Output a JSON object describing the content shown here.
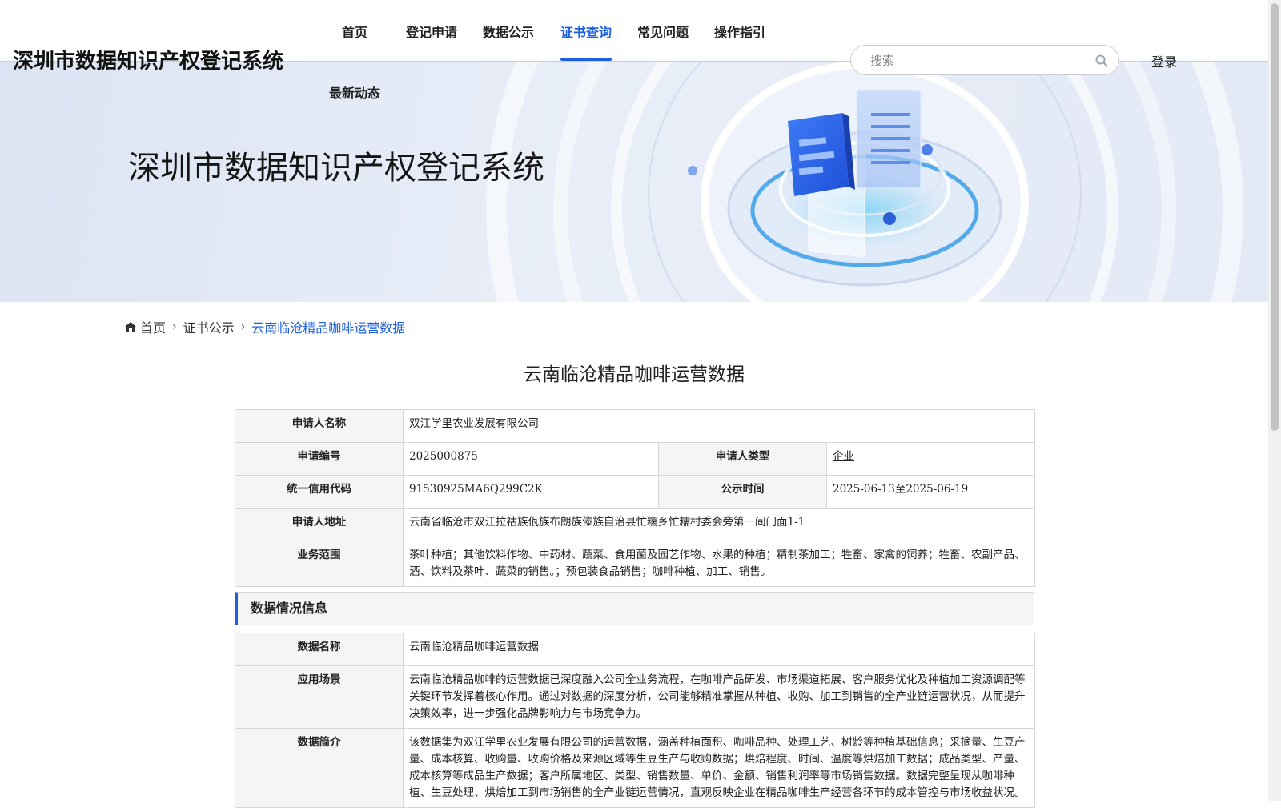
{
  "header": {
    "site_title": "深圳市数据知识产权登记系统",
    "nav": [
      {
        "label": "首页"
      },
      {
        "label": "登记申请"
      },
      {
        "label": "数据公示"
      },
      {
        "label": "证书查询",
        "active": true
      },
      {
        "label": "常见问题"
      },
      {
        "label": "操作指引"
      },
      {
        "label": "最新动态"
      }
    ],
    "search": {
      "placeholder": "搜索"
    },
    "login_label": "登录",
    "accent_color": "#1d5fe0"
  },
  "banner": {
    "title": "深圳市数据知识产权登记系统"
  },
  "breadcrumb": {
    "home": "首页",
    "section": "证书公示",
    "current": "云南临沧精品咖啡运营数据"
  },
  "detail": {
    "title": "云南临沧精品咖啡运营数据",
    "applicant": {
      "name_label": "申请人名称",
      "name": "双江学里农业发展有限公司",
      "number_label": "申请编号",
      "number": "2025000875",
      "type_label": "申请人类型",
      "type": "企业",
      "credit_label": "统一信用代码",
      "credit": "91530925MA6Q299C2K",
      "publicity_label": "公示时间",
      "publicity": "2025-06-13至2025-06-19",
      "address_label": "申请人地址",
      "address": "云南省临沧市双江拉祜族佤族布朗族傣族自治县忙糯乡忙糯村委会旁第一间门面1-1",
      "scope_label": "业务范围",
      "scope": "茶叶种植；其他饮料作物、中药材、蔬菜、食用菌及园艺作物、水果的种植；精制茶加工；牲畜、家禽的饲养；牲畜、农副产品、酒、饮料及茶叶、蔬菜的销售。；预包装食品销售；咖啡种植、加工、销售。"
    },
    "data_section_title": "数据情况信息",
    "data_info": {
      "name_label": "数据名称",
      "name": "云南临沧精品咖啡运营数据",
      "scenario_label": "应用场景",
      "scenario": "云南临沧精品咖啡的运营数据已深度融入公司全业务流程，在咖啡产品研发、市场渠道拓展、客户服务优化及种植加工资源调配等关键环节发挥着核心作用。通过对数据的深度分析，公司能够精准掌握从种植、收购、加工到销售的全产业链运营状况，从而提升决策效率，进一步强化品牌影响力与市场竞争力。",
      "intro_label": "数据简介",
      "intro": "该数据集为双江学里农业发展有限公司的运营数据，涵盖种植面积、咖啡品种、处理工艺、树龄等种植基础信息；采摘量、生豆产量、成本核算、收购量、收购价格及来源区域等生豆生产与收购数据；烘焙程度、时间、温度等烘焙加工数据；成品类型、产量、成本核算等成品生产数据；客户所属地区、类型、销售数量、单价、金额、销售利润率等市场销售数据。数据完整呈现从咖啡种植、生豆处理、烘焙加工到市场销售的全产业链运营情况，直观反映企业在精品咖啡生产经营各环节的成本管控与市场收益状况。"
    }
  }
}
